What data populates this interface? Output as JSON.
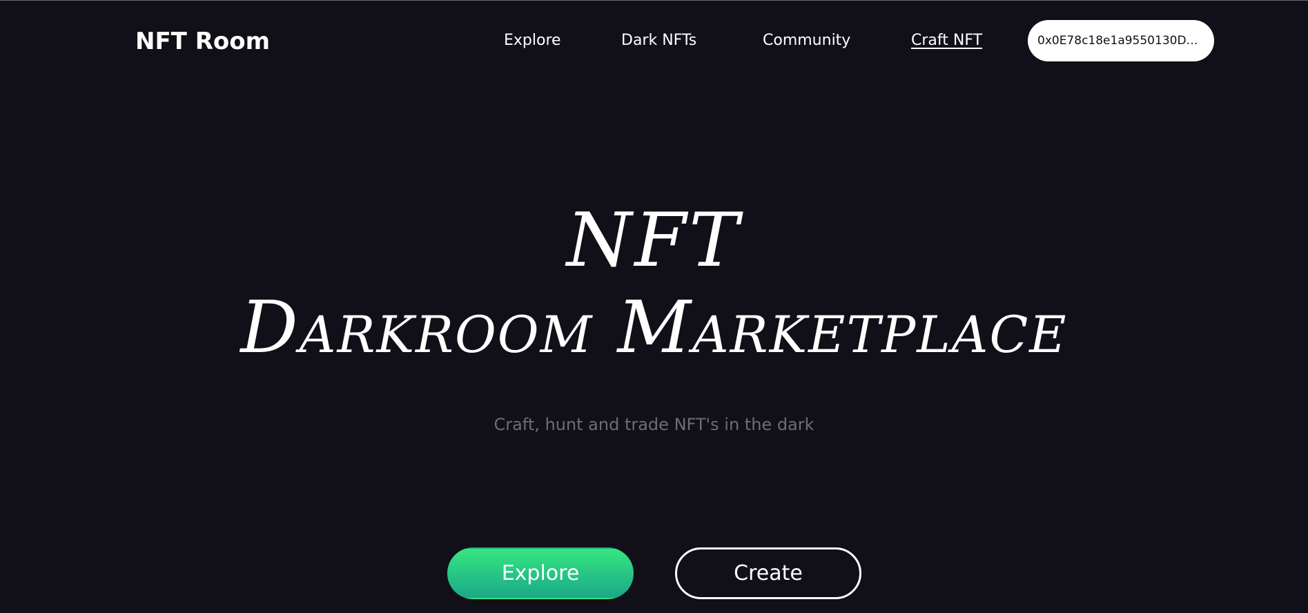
{
  "header": {
    "logo": "NFT Room",
    "nav": [
      {
        "label": "Explore"
      },
      {
        "label": "Dark NFTs"
      },
      {
        "label": "Community"
      },
      {
        "label": "Craft NFT"
      }
    ],
    "wallet_address": "0x0E78c18e1a9550130D2..."
  },
  "hero": {
    "title_line1": "NFT",
    "title_line2": "Darkroom Marketplace",
    "subtitle": "Craft, hunt and trade NFT's in the dark",
    "explore_label": "Explore",
    "create_label": "Create"
  },
  "colors": {
    "background": "#111018",
    "accent_gradient_start": "#36e67f",
    "accent_gradient_end": "#1aa889",
    "subtitle_text": "#6d6d76"
  }
}
